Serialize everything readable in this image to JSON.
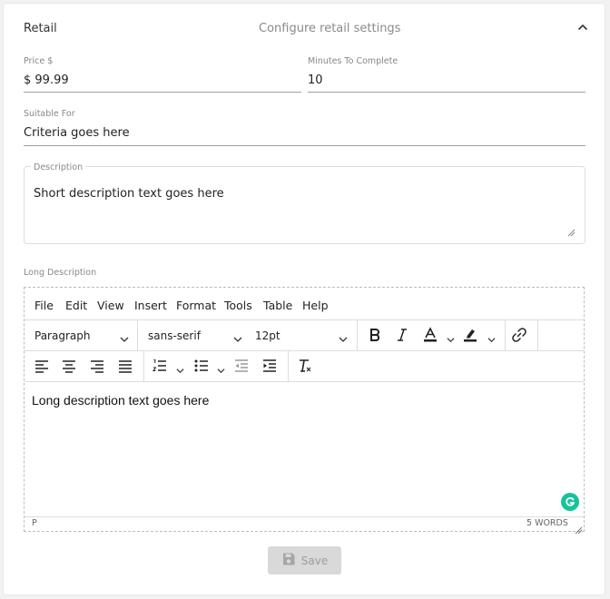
{
  "section": {
    "title": "Retail",
    "subtitle": "Configure retail settings"
  },
  "fields": {
    "price": {
      "label": "Price $",
      "value": "$ 99.99"
    },
    "minutes": {
      "label": "Minutes To Complete",
      "value": "10"
    },
    "suitable": {
      "label": "Suitable For",
      "value": "Criteria goes here"
    },
    "description": {
      "label": "Description",
      "value": "Short description text goes here"
    },
    "long_description": {
      "label": "Long Description"
    }
  },
  "editor": {
    "menu": [
      "File",
      "Edit",
      "View",
      "Insert",
      "Format",
      "Tools",
      "Table",
      "Help"
    ],
    "block_format": "Paragraph",
    "font_family": "sans-serif",
    "font_size": "12pt",
    "content": "Long description text goes here",
    "status_path": "P",
    "word_count": "5 WORDS"
  },
  "actions": {
    "save_label": "Save"
  },
  "colors": {
    "grammarly": "#15c39a",
    "save_disabled_bg": "#d9d9d9",
    "save_disabled_text": "#9c9c9c"
  },
  "icons": [
    "chevron-up-icon",
    "bold-icon",
    "italic-icon",
    "text-color-icon",
    "highlight-icon",
    "link-icon",
    "align-left-icon",
    "align-center-icon",
    "align-right-icon",
    "align-justify-icon",
    "numbered-list-icon",
    "bullet-list-icon",
    "outdent-icon",
    "indent-icon",
    "clear-format-icon",
    "resize-handle-icon",
    "grammarly-icon",
    "floppy-disk-icon"
  ]
}
